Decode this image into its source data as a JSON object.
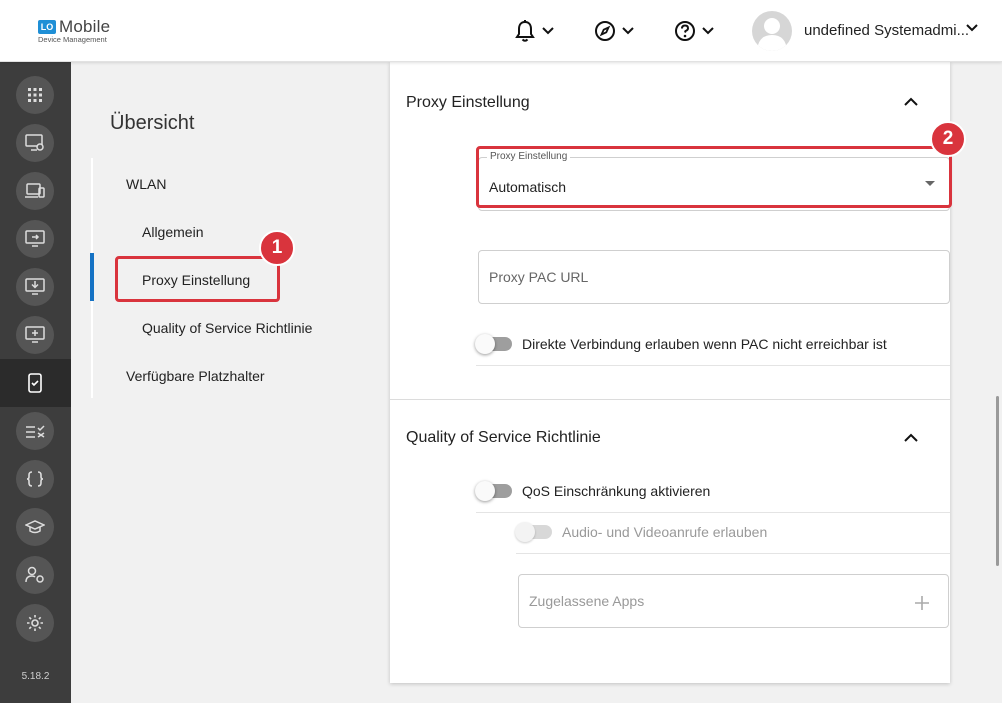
{
  "header": {
    "logo_mark": "LO",
    "logo_title": "Mobile",
    "logo_subtitle": "Device Management",
    "user_name": "undefined Systemadmi...",
    "icons": [
      "bell-icon",
      "compass-icon",
      "help-icon"
    ]
  },
  "rail": {
    "icons": [
      "apps-grid-icon",
      "device-settings-icon",
      "devices-icon",
      "screen-share-icon",
      "download-device-icon",
      "add-device-icon",
      "mobile-check-icon",
      "checklist-icon",
      "braces-icon",
      "graduation-icon",
      "user-settings-icon",
      "gear-icon"
    ],
    "active_index": 6,
    "version": "5.18.2"
  },
  "overview": {
    "title": "Übersicht",
    "items": [
      {
        "label": "WLAN",
        "level": 1
      },
      {
        "label": "Allgemein",
        "level": 2
      },
      {
        "label": "Proxy Einstellung",
        "level": 2,
        "active": true
      },
      {
        "label": "Quality of Service Richtlinie",
        "level": 2
      },
      {
        "label": "Verfügbare Platzhalter",
        "level": 1
      }
    ]
  },
  "callouts": [
    "1",
    "2"
  ],
  "proxy_section": {
    "title": "Proxy Einstellung",
    "select_legend": "Proxy Einstellung",
    "select_value": "Automatisch",
    "pac_placeholder": "Proxy PAC URL",
    "direct_toggle_label": "Direkte Verbindung erlauben wenn PAC nicht erreichbar ist",
    "direct_toggle_on": false
  },
  "qos_section": {
    "title": "Quality of Service Richtlinie",
    "qos_toggle_label": "QoS Einschränkung aktivieren",
    "qos_toggle_on": false,
    "av_toggle_label": "Audio- und Videoanrufe erlauben",
    "av_toggle_disabled": true,
    "apps_placeholder": "Zugelassene Apps"
  },
  "colors": {
    "accent": "#1572c4",
    "callout": "#d9343d",
    "rail": "#3d3d3d"
  }
}
